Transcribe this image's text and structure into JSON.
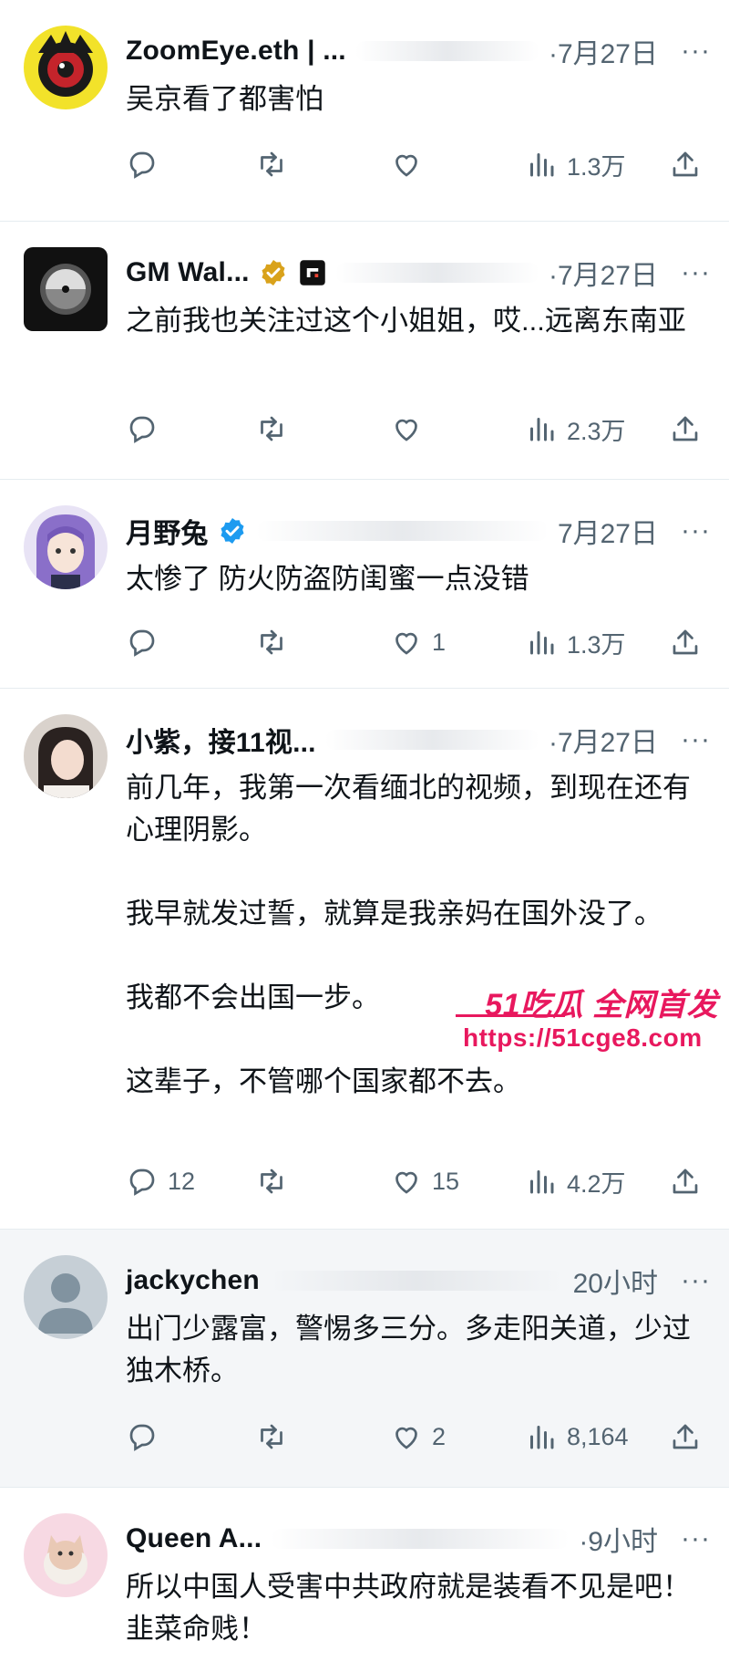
{
  "tweets": [
    {
      "name": "ZoomEye.eth | ...",
      "time": "·7月27日",
      "more": "···",
      "text": [
        "吴京看了都害怕"
      ],
      "replies": "",
      "retweets": "",
      "likes": "",
      "views": "1.3万"
    },
    {
      "name": "GM Wal...",
      "time": "·7月27日",
      "more": "···",
      "text": [
        "之前我也关注过这个小姐姐，哎...远离东南亚"
      ],
      "replies": "",
      "retweets": "",
      "likes": "",
      "views": "2.3万"
    },
    {
      "name": "月野兔",
      "time": "7月27日",
      "more": "···",
      "text": [
        "太惨了 防火防盗防闺蜜一点没错"
      ],
      "replies": "",
      "retweets": "",
      "likes": "1",
      "views": "1.3万"
    },
    {
      "name": "小紫，接11视...",
      "time": "·7月27日",
      "more": "···",
      "text": [
        "前几年，我第一次看缅北的视频，到现在还有心理阴影。",
        "我早就发过誓，就算是我亲妈在国外没了。",
        "我都不会出国一步。",
        "这辈子，不管哪个国家都不去。"
      ],
      "replies": "12",
      "retweets": "",
      "likes": "15",
      "views": "4.2万"
    },
    {
      "name": "jackychen",
      "time": "20小时",
      "more": "···",
      "text": [
        "出门少露富，警惕多三分。多走阳关道，少过独木桥。"
      ],
      "replies": "",
      "retweets": "",
      "likes": "2",
      "views": "8,164"
    },
    {
      "name": "Queen A...",
      "time": "·9小时",
      "more": "···",
      "text": [
        "所以中国人受害中共政府就是装看不见是吧！韭菜命贱！"
      ],
      "replies": "",
      "retweets": "",
      "likes": "",
      "views": ""
    }
  ],
  "watermark": {
    "brand": "51吃瓜 全网首发",
    "url": "https://51cge8.com"
  },
  "colors": {
    "text": "#0f1419",
    "muted": "#536471",
    "verified_gold": "#d9a21b",
    "verified_blue": "#1d9bf0",
    "watermark": "#e8185e"
  },
  "icons": [
    "reply-icon",
    "retweet-icon",
    "like-icon",
    "views-icon",
    "share-icon",
    "more-icon"
  ]
}
